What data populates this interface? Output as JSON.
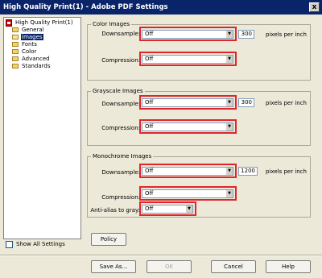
{
  "window": {
    "title": "High Quality Print(1) - Adobe PDF Settings",
    "close_glyph": "x"
  },
  "tree": {
    "root": "High Quality Print(1)",
    "items": [
      {
        "label": "General",
        "selected": false
      },
      {
        "label": "Images",
        "selected": true
      },
      {
        "label": "Fonts",
        "selected": false
      },
      {
        "label": "Color",
        "selected": false
      },
      {
        "label": "Advanced",
        "selected": false
      },
      {
        "label": "Standards",
        "selected": false
      }
    ]
  },
  "color_images": {
    "title": "Color Images",
    "downsample_label": "Downsample:",
    "downsample_value": "Off",
    "ppi_value": "300",
    "ppi_unit": "pixels per inch",
    "compression_label": "Compression:",
    "compression_value": "Off"
  },
  "grayscale_images": {
    "title": "Grayscale Images",
    "downsample_label": "Downsample:",
    "downsample_value": "Off",
    "ppi_value": "300",
    "ppi_unit": "pixels per inch",
    "compression_label": "Compression:",
    "compression_value": "Off"
  },
  "monochrome_images": {
    "title": "Monochrome Images",
    "downsample_label": "Downsample:",
    "downsample_value": "Off",
    "ppi_value": "1200",
    "ppi_unit": "pixels per inch",
    "compression_label": "Compression:",
    "compression_value": "Off",
    "antialias_label": "Anti-alias to gray:",
    "antialias_value": "Off"
  },
  "show_all_settings": {
    "label": "Show All Settings",
    "checked": false
  },
  "buttons": {
    "policy": "Policy",
    "save_as": "Save As...",
    "ok": "OK",
    "cancel": "Cancel",
    "help": "Help"
  },
  "colors": {
    "titlebar": "#0a246a",
    "highlight_box": "#e0262b",
    "dialog_bg": "#ece9d8"
  },
  "icons": {
    "dropdown": "chevron-down-icon",
    "root": "pdf-settings-icon",
    "folder": "folder-icon"
  }
}
